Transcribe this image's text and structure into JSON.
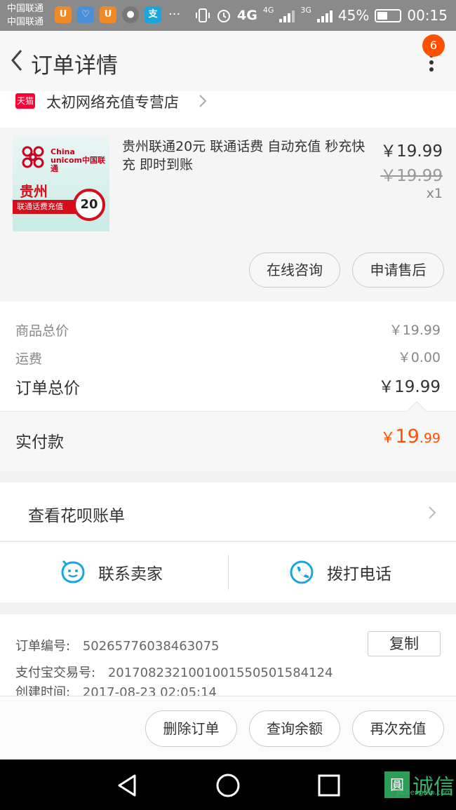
{
  "status_bar": {
    "carrier1": "中国联通",
    "carrier2": "中国联通",
    "net1": "4G",
    "net2": "4G",
    "net3": "3G",
    "battery": "45%",
    "battery_level": 0.45,
    "time": "00:15",
    "app_icons": [
      "uc-browser-icon",
      "health-icon",
      "uc-browser-icon",
      "avatar-icon",
      "alipay-icon"
    ],
    "overflow": "···"
  },
  "header": {
    "title": "订单详情",
    "badge_count": "6"
  },
  "store": {
    "badge": "天猫",
    "name": "太初网络充值专营店"
  },
  "product": {
    "title": "贵州联通20元 联通话费 自动充值 秒充快充 即时到账",
    "price": "￥19.99",
    "original_price": "￥19.99",
    "quantity": "x1",
    "thumb_brand_line1": "China",
    "thumb_brand_line2": "unicom中国联通",
    "thumb_province": "贵州",
    "thumb_ribbon": "联通话费充值",
    "thumb_amount": "20",
    "consult_label": "在线咨询",
    "aftersale_label": "申请售后"
  },
  "summary": {
    "goods_label": "商品总价",
    "goods_value": "￥19.99",
    "shipping_label": "运费",
    "shipping_value": "￥0.00",
    "total_label": "订单总价",
    "total_value": "￥19.99",
    "paid_label": "实付款",
    "paid_currency": "￥",
    "paid_integer": "19",
    "paid_decimal": ".99",
    "accent_color": "#ff5000"
  },
  "huabei": {
    "label": "查看花呗账单"
  },
  "contact": {
    "seller_label": "联系卖家",
    "call_label": "拨打电话",
    "icon_color": "#1aa5e0"
  },
  "order_info": {
    "order_no_label": "订单编号:",
    "order_no": "50265776038463075",
    "copy_label": "复制",
    "alipay_no_label": "支付宝交易号:",
    "alipay_no": "2017082321001001550501584124",
    "created_label": "创建时间:",
    "created": "2017-08-23 02:05:14"
  },
  "actions": {
    "delete_label": "删除订单",
    "balance_label": "查询余额",
    "recharge_label": "再次充值"
  },
  "watermark": {
    "box": "圓",
    "text": "诚信",
    "sub": "JiChengXin.com"
  }
}
